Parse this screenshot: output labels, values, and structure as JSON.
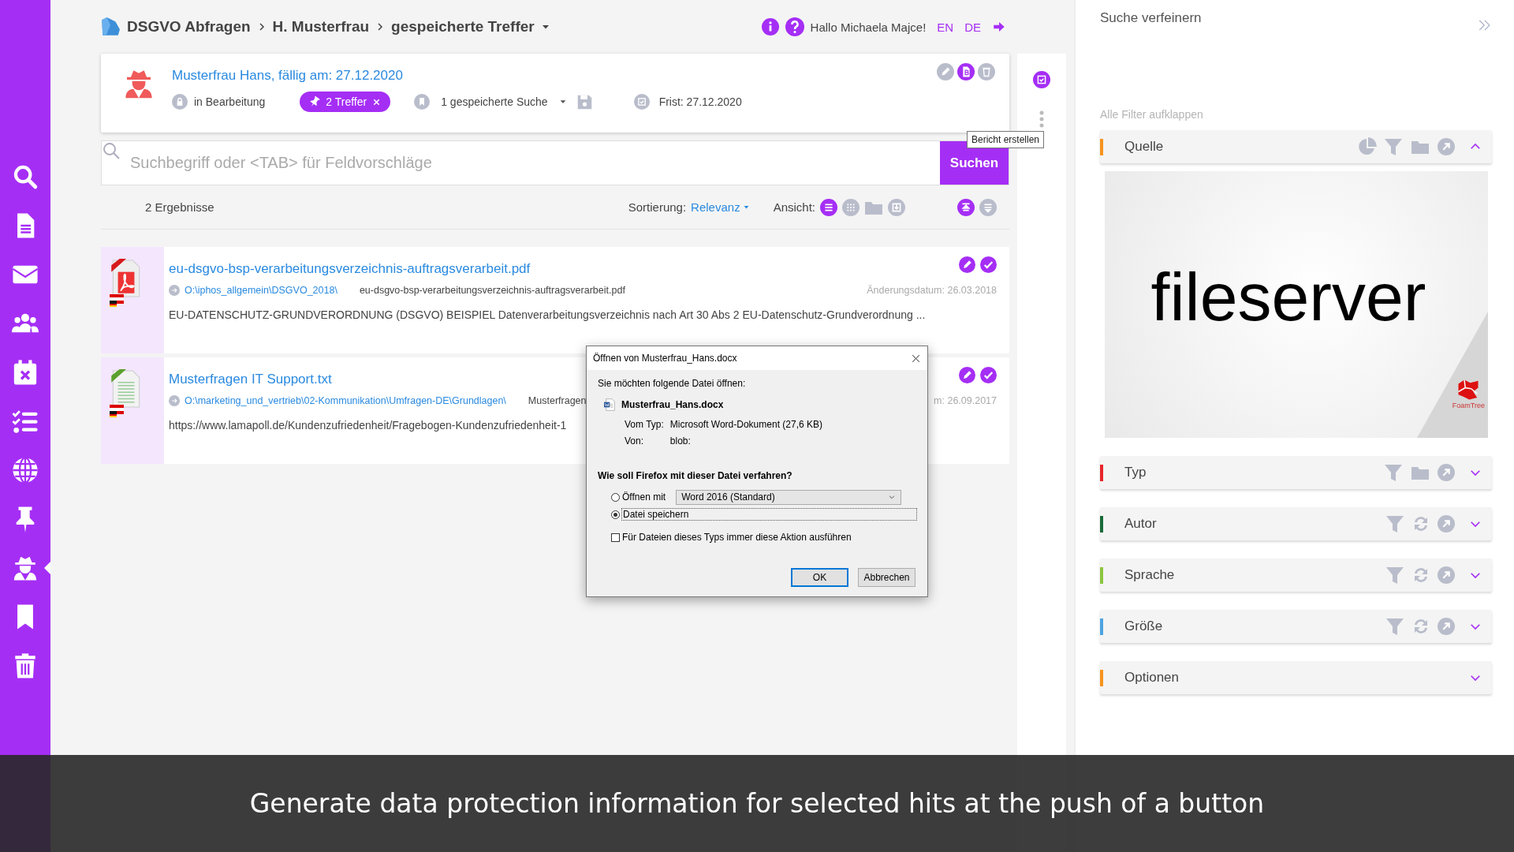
{
  "sidebar": {
    "items": [
      {
        "selected": false
      },
      {
        "selected": false
      },
      {
        "selected": false
      },
      {
        "selected": false
      },
      {
        "selected": false
      },
      {
        "selected": false
      },
      {
        "selected": false
      },
      {
        "selected": false
      },
      {
        "selected": true
      },
      {
        "selected": false
      },
      {
        "selected": false
      }
    ]
  },
  "breadcrumb": [
    "DSGVO Abfragen",
    "H. Musterfrau",
    "gespeicherte Treffer"
  ],
  "header": {
    "greeting": "Hallo Michaela Majce!",
    "languages": [
      "EN",
      "DE"
    ]
  },
  "case": {
    "title": "Musterfrau Hans, fällig am: 27.12.2020",
    "status": "in Bearbeitung",
    "hits": "2 Treffer",
    "saved_search": "1 gespeicherte Suche",
    "deadline": "Frist: 27.12.2020",
    "tooltip": "Bericht erstellen"
  },
  "search": {
    "placeholder": "Suchbegriff oder <TAB> für Feldvorschläge",
    "button": "Suchen"
  },
  "results_bar": {
    "count": "2 Ergebnisse",
    "sort_label": "Sortierung:",
    "sort_value": "Relevanz",
    "view_label": "Ansicht:",
    "views": [
      {
        "selected": true
      },
      {
        "selected": false
      },
      {
        "selected": false
      },
      {
        "selected": false
      }
    ]
  },
  "results": [
    {
      "kind": "pdf",
      "title": "eu-dsgvo-bsp-verarbeitungsverzeichnis-auftragsverarbeit.pdf",
      "path": "O:\\iphos_allgemein\\DSGVO_2018\\",
      "filename": "eu-dsgvo-bsp-verarbeitungsverzeichnis-auftragsverarbeit.pdf",
      "date": "Änderungsdatum: 26.03.2018",
      "snippet": "EU-DATENSCHUTZ-GRUNDVERORDNUNG (DSGVO) BEISPIEL Datenverarbeitungsverzeichnis nach Art 30 Abs 2 EU-Datenschutz-Grundverordnung ..."
    },
    {
      "kind": "txt",
      "title": "Musterfragen IT Support.txt",
      "path": "O:\\marketing_und_vertrieb\\02-Kommunikation\\Umfragen-DE\\Grundlagen\\",
      "filename": "Musterfragen",
      "date": "m: 26.09.2017",
      "snippet": "https://www.lamapoll.de/Kundenzufriedenheit/Fragebogen-Kundenzufriedenheit-1"
    }
  ],
  "dialog": {
    "title": "Öffnen von Musterfrau_Hans.docx",
    "intro": "Sie möchten folgende Datei öffnen:",
    "filename": "Musterfrau_Hans.docx",
    "type_label": "Vom Typ:",
    "type_value": "Microsoft Word-Dokument (27,6 KB)",
    "from_label": "Von:",
    "from_value": "blob:",
    "question": "Wie soll Firefox mit dieser Datei verfahren?",
    "options": [
      {
        "label": "Öffnen mit",
        "selected": false
      },
      {
        "label": "Datei speichern",
        "selected": true
      }
    ],
    "app": "Word 2016 (Standard)",
    "remember": {
      "label": "Für Dateien dieses Typs immer diese Aktion ausführen",
      "checked": false
    },
    "buttons": [
      "OK",
      "Abbrechen"
    ]
  },
  "refine": {
    "title": "Suche verfeinern",
    "expand_all": "Alle Filter aufklappen",
    "filters": [
      {
        "kind": "source",
        "label": "Quelle",
        "color": "#f7941d",
        "expanded": true
      },
      {
        "kind": "type",
        "label": "Typ",
        "color": "#e8262b",
        "expanded": false
      },
      {
        "kind": "facet",
        "label": "Autor",
        "color": "#1a6b3a",
        "expanded": false
      },
      {
        "kind": "facet",
        "label": "Sprache",
        "color": "#8dc63f",
        "expanded": false
      },
      {
        "kind": "facet",
        "label": "Größe",
        "color": "#4da3e0",
        "expanded": false
      },
      {
        "kind": "options",
        "label": "Optionen",
        "color": "#f7941d",
        "expanded": false
      }
    ],
    "treemap": {
      "label": "fileserver",
      "badge": "FoamTree"
    }
  },
  "caption": "Generate data protection information for selected hits at the push of a button"
}
